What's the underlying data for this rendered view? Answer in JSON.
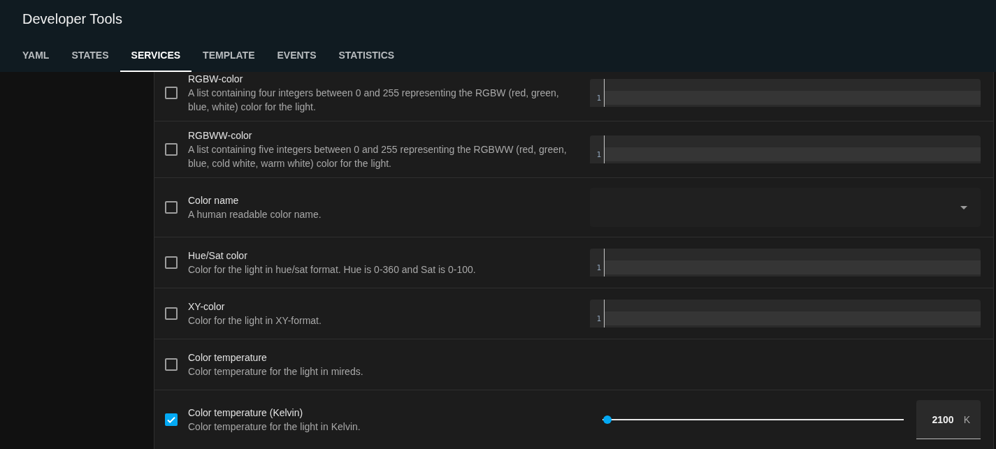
{
  "header": {
    "title": "Developer Tools",
    "tabs": [
      {
        "label": "YAML",
        "selected": false
      },
      {
        "label": "STATES",
        "selected": false
      },
      {
        "label": "SERVICES",
        "selected": true
      },
      {
        "label": "TEMPLATE",
        "selected": false
      },
      {
        "label": "EVENTS",
        "selected": false
      },
      {
        "label": "STATISTICS",
        "selected": false
      }
    ]
  },
  "fields": [
    {
      "kind": "code",
      "checked": false,
      "name": "RGBW-color",
      "description": "A list containing four integers between 0 and 255 representing the RGBW (red, green, blue, white) color for the light.",
      "line_number": "1"
    },
    {
      "kind": "code",
      "checked": false,
      "name": "RGBWW-color",
      "description": "A list containing five integers between 0 and 255 representing the RGBWW (red, green, blue, cold white, warm white) color for the light.",
      "line_number": "1"
    },
    {
      "kind": "select",
      "checked": false,
      "name": "Color name",
      "description": "A human readable color name."
    },
    {
      "kind": "code",
      "checked": false,
      "name": "Hue/Sat color",
      "description": "Color for the light in hue/sat format. Hue is 0-360 and Sat is 0-100.",
      "line_number": "1"
    },
    {
      "kind": "code",
      "checked": false,
      "name": "XY-color",
      "description": "Color for the light in XY-format.",
      "line_number": "1"
    },
    {
      "kind": "none",
      "checked": false,
      "name": "Color temperature",
      "description": "Color temperature for the light in mireds."
    },
    {
      "kind": "slider",
      "checked": true,
      "name": "Color temperature (Kelvin)",
      "description": "Color temperature for the light in Kelvin.",
      "level": 0.016,
      "value": "2100",
      "unit": "K"
    }
  ]
}
